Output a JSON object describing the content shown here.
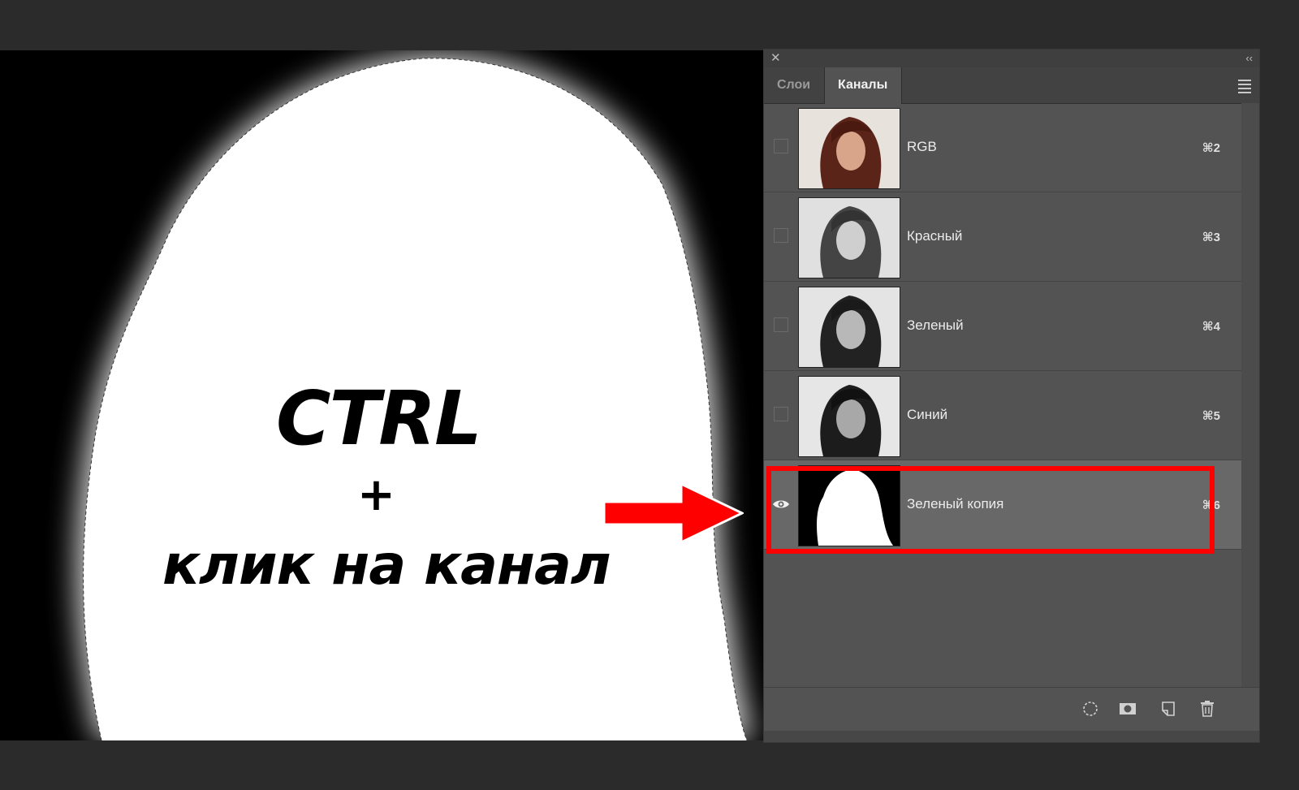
{
  "canvas": {
    "caption_ctrl": "CTRL",
    "caption_plus": "+",
    "caption_click": "клик на канал"
  },
  "panel": {
    "close_symbol": "✕",
    "collapse_symbol": "‹‹",
    "tabs": [
      {
        "label": "Слои",
        "active": false
      },
      {
        "label": "Каналы",
        "active": true
      }
    ],
    "channels": [
      {
        "name": "RGB",
        "shortcut": "⌘2",
        "visible": false,
        "selected": false,
        "thumb": "color"
      },
      {
        "name": "Красный",
        "shortcut": "⌘3",
        "visible": false,
        "selected": false,
        "thumb": "gray"
      },
      {
        "name": "Зеленый",
        "shortcut": "⌘4",
        "visible": false,
        "selected": false,
        "thumb": "gray"
      },
      {
        "name": "Синий",
        "shortcut": "⌘5",
        "visible": false,
        "selected": false,
        "thumb": "gray"
      },
      {
        "name": "Зеленый копия",
        "shortcut": "⌘6",
        "visible": true,
        "selected": true,
        "thumb": "mask"
      }
    ],
    "bottom_icons": [
      "load-selection-icon",
      "save-mask-icon",
      "new-channel-icon",
      "trash-icon"
    ]
  },
  "colors": {
    "highlight": "#ff0000",
    "arrow": "#ff0000",
    "panel_bg": "#535353",
    "selected_row": "#686868"
  }
}
